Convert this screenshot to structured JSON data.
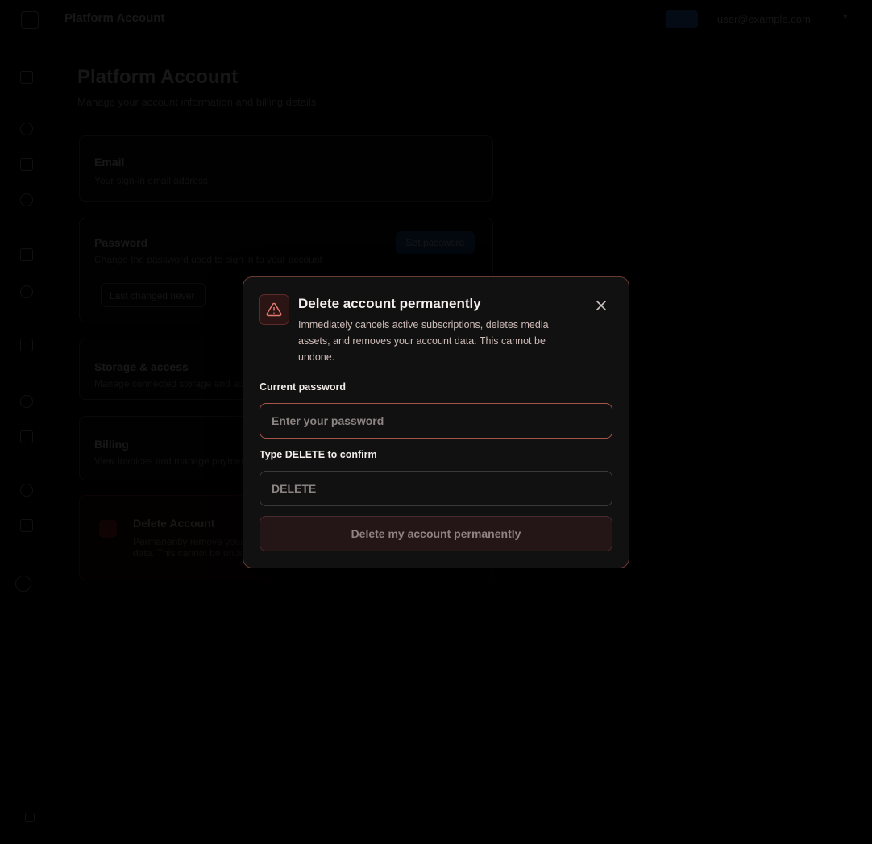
{
  "background": {
    "app_title": "Platform Account",
    "user_email": "user@example.com",
    "page_title": "Platform Account",
    "page_subtitle": "Manage your account information and billing details",
    "cards": [
      {
        "title": "Email",
        "desc": "Your sign-in email address"
      },
      {
        "title": "Password",
        "desc": "Change the password used to sign in to your account",
        "action": "Set password",
        "chip": "Last changed never"
      },
      {
        "title": "Storage & access",
        "desc": "Manage connected storage and access keys"
      },
      {
        "title": "Billing",
        "desc": "View invoices and manage payment methods"
      },
      {
        "title": "Delete Account",
        "desc": "Permanently remove your account and all associated data. This cannot be undone."
      }
    ]
  },
  "modal": {
    "title": "Delete account permanently",
    "description": "Immediately cancels active subscriptions, deletes media assets, and removes your account data. This cannot be undone.",
    "password_label": "Current password",
    "password_placeholder": "Enter your password",
    "confirm_label": "Type DELETE to confirm",
    "confirm_placeholder": "DELETE",
    "submit_label": "Delete my account permanently",
    "icons": {
      "warning": "warning-triangle-icon",
      "close": "close-icon"
    },
    "colors": {
      "accent_border": "#a4554a",
      "danger_bg": "#241617"
    }
  }
}
